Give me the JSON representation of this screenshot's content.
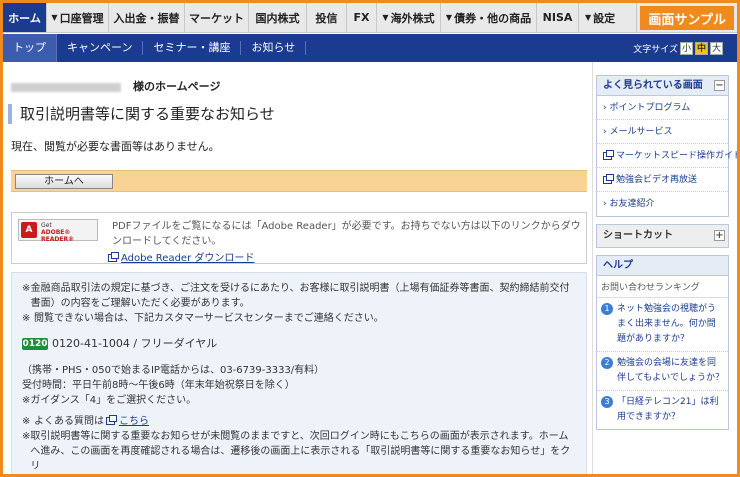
{
  "topnav": {
    "items": [
      {
        "label": "ホーム",
        "tri": ""
      },
      {
        "label": "口座管理",
        "tri": "▼"
      },
      {
        "label": "入出金・振替",
        "tri": ""
      },
      {
        "label": "マーケット",
        "tri": ""
      },
      {
        "label": "国内株式",
        "tri": ""
      },
      {
        "label": "投信",
        "tri": ""
      },
      {
        "label": "FX",
        "tri": ""
      },
      {
        "label": "海外株式",
        "tri": "▼"
      },
      {
        "label": "債券・他の商品",
        "tri": "▼"
      },
      {
        "label": "NISA",
        "tri": ""
      },
      {
        "label": "設定",
        "tri": "▼"
      }
    ],
    "sample_label": "画面サンプル"
  },
  "subnav": {
    "items": [
      "トップ",
      "キャンペーン",
      "セミナー・講座",
      "お知らせ"
    ],
    "font_size_label": "文字サイズ",
    "font_sizes": [
      "小",
      "中",
      "大"
    ]
  },
  "main": {
    "home_title_suffix": "様のホームページ",
    "page_title": "取引説明書等に関する重要なお知らせ",
    "notice": "現在、閲覧が必要な書面等はありません。",
    "home_button": "ホームへ",
    "reader": {
      "badge_get": "Get",
      "badge_name": "ADOBE® READER®",
      "text": "PDFファイルをご覧になるには「Adobe Reader」が必要です。お持ちでない方は以下のリンクからダウンロードしてください。",
      "download_link": "Adobe Reader ダウンロード"
    },
    "info": {
      "mark": "※",
      "line1": "金融商品取引法の規定に基づき、ご注文を受けるにあたり、お客様に取引説明書（上場有価証券等書面、契約締結前交付書面）の内容をご理解いただく必要があります。",
      "line2": "閲覧できない場合は、下記カスタマーサービスセンターまでご連絡ください。",
      "phone_icon": "free-dial-icon",
      "phone": "0120-41-1004 / フリーダイヤル",
      "mobile": "（携帯・PHS・050で始まるIP電話からは、03-6739-3333/有料）",
      "hours": "受付時間：平日午前8時〜午後6時（年末年始祝祭日を除く）",
      "guidance": "※ガイダンス「4」をご選択ください。",
      "faq_prefix": "よくある質問は",
      "faq_link": "こちら",
      "line3": "取引説明書等に関する重要なお知らせが未閲覧のままですと、次回ログイン時にもこちらの画面が表示されます。ホームへ進み、この画面を再度確認される場合は、遷移後の画面上に表示される「取引説明書等に関する重要なお知らせ」をクリ"
    }
  },
  "sidebar": {
    "popular": {
      "title": "よく見られている画面",
      "toggle": "−",
      "items": [
        {
          "label": "ポイントプログラム",
          "icon": "arrow"
        },
        {
          "label": "メールサービス",
          "icon": "arrow"
        },
        {
          "label": "マーケットスピード操作ガイド",
          "icon": "ext"
        },
        {
          "label": "勉強会ビデオ再放送",
          "icon": "ext"
        },
        {
          "label": "お友達紹介",
          "icon": "arrow"
        }
      ]
    },
    "shortcut": {
      "title": "ショートカット",
      "toggle": "+"
    },
    "help": {
      "title": "ヘルプ",
      "subtitle": "お問い合わせランキング",
      "questions": [
        {
          "num": "1",
          "text": "ネット勉強会の視聴がうまく出来ません。何か問題がありますか？"
        },
        {
          "num": "2",
          "text": "勉強会の会場に友達を同伴してもよいでしょうか？"
        },
        {
          "num": "3",
          "text": "「日経テレコン21」は利用できますか？"
        }
      ]
    }
  }
}
